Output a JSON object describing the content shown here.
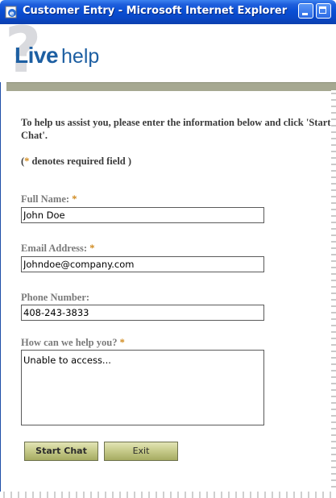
{
  "window": {
    "title": "Customer Entry - Microsoft Internet Explorer",
    "icon": "ie-icon"
  },
  "header": {
    "brand_live": "Live",
    "brand_help": "help",
    "mark": "?"
  },
  "intro": {
    "text": "To help us assist you, please enter the information below and click 'Start Chat'.",
    "required_open": "(",
    "required_star": "*",
    "required_text": " denotes required field )"
  },
  "form": {
    "full_name_label": "Full Name:",
    "full_name_value": "John Doe",
    "email_label": "Email Address:",
    "email_value": "Johndoe@company.com",
    "phone_label": "Phone Number:",
    "phone_value": "408-243-3833",
    "help_label": "How can we help you?",
    "help_value": "Unable to access...",
    "star": "*"
  },
  "buttons": {
    "start_label": "Start Chat",
    "exit_label": "Exit"
  },
  "colors": {
    "title_bar": "#0a4fd4",
    "brand": "#1d5fa2",
    "required_star": "#d08a1e",
    "header_bar": "#a6a891",
    "button": "#c8cc8c"
  }
}
